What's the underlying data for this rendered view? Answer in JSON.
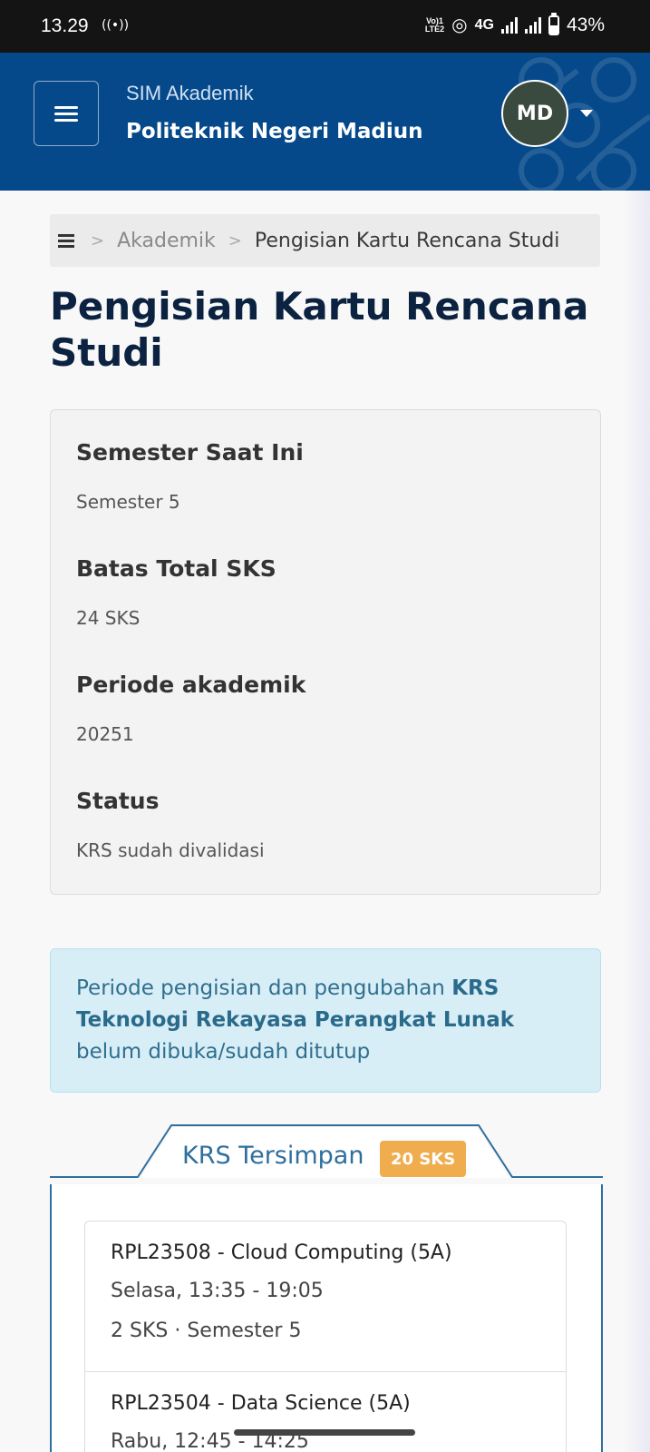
{
  "status_bar": {
    "time": "13.29",
    "volte": "Vo) 1 LTE2",
    "network": "4G",
    "battery": "43%"
  },
  "header": {
    "app_name": "SIM Akademik",
    "institution": "Politeknik Negeri Madiun",
    "user_initials": "MD"
  },
  "breadcrumb": {
    "items": [
      "Akademik",
      "Pengisian Kartu Rencana Studi"
    ]
  },
  "page": {
    "title": "Pengisian Kartu Rencana Studi"
  },
  "info": [
    {
      "label": "Semester Saat Ini",
      "value": "Semester 5"
    },
    {
      "label": "Batas Total SKS",
      "value": "24 SKS"
    },
    {
      "label": "Periode akademik",
      "value": "20251"
    },
    {
      "label": "Status",
      "value": "KRS sudah divalidasi"
    }
  ],
  "alert": {
    "prefix": "Periode pengisian dan pengubahan ",
    "bold": "KRS Teknologi Rekayasa Perangkat Lunak",
    "suffix": " belum dibuka/sudah ditutup"
  },
  "krs_tab": {
    "label": "KRS Tersimpan",
    "badge": "20 SKS"
  },
  "courses": [
    {
      "title": "RPL23508 - Cloud Computing (5A)",
      "schedule": "Selasa, 13:35 - 19:05",
      "meta": "2 SKS · Semester 5"
    },
    {
      "title": "RPL23504 - Data Science (5A)",
      "schedule": "Rabu, 12:45 - 14:25",
      "meta": ""
    }
  ],
  "colors": {
    "header_bg": "#05498a",
    "accent": "#2e6f9e",
    "badge": "#f0ad4e",
    "alert_bg": "#d8eef7"
  },
  "icons": {
    "menu": "hamburger-icon",
    "breadcrumb_home": "list-icon",
    "avatar_caret": "caret-down-icon"
  }
}
